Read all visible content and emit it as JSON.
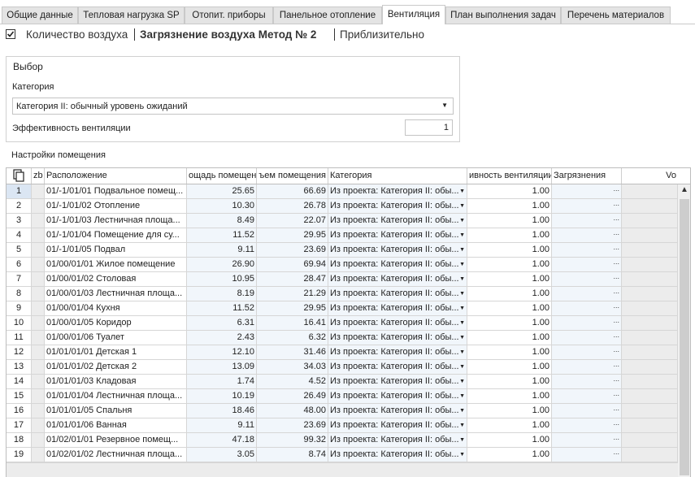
{
  "tabs": [
    {
      "label": "Общие данные",
      "active": false
    },
    {
      "label": "Тепловая нагрузка SP",
      "active": false
    },
    {
      "label": "Отопит. приборы",
      "active": false
    },
    {
      "label": "Панельное отопление",
      "active": false
    },
    {
      "label": "Вентиляция",
      "active": true
    },
    {
      "label": "План выполнения задач",
      "active": false
    },
    {
      "label": "Перечень материалов",
      "active": false
    }
  ],
  "mode": {
    "checked": true,
    "items": [
      "Количество воздуха",
      "Загрязнение воздуха Метод № 2",
      "Приблизительно"
    ],
    "active_index": 1
  },
  "selection": {
    "title": "Выбор",
    "category_label": "Категория",
    "category_value": "Категория II: обычный уровень ожиданий",
    "efficiency_label": "Эффективность вентиляции",
    "efficiency_value": "1"
  },
  "room_settings_label": "Настройки помещения",
  "grid": {
    "copy_icon": "copy-icon",
    "columns": [
      "zb",
      "Расположение",
      "ощадь помещения",
      "ъем помещения",
      "Категория",
      "ивность вентиляции",
      "Загрязнения",
      "Vo"
    ],
    "rows": [
      {
        "n": "1",
        "loc": "01/-1/01/01 Подвальное помещ...",
        "area": "25.65",
        "vol": "66.69",
        "cat": "Из проекта: Категория II: обы...",
        "eff": "1.00"
      },
      {
        "n": "2",
        "loc": "01/-1/01/02 Отопление",
        "area": "10.30",
        "vol": "26.78",
        "cat": "Из проекта: Категория II: обы...",
        "eff": "1.00"
      },
      {
        "n": "3",
        "loc": "01/-1/01/03 Лестничная площа...",
        "area": "8.49",
        "vol": "22.07",
        "cat": "Из проекта: Категория II: обы...",
        "eff": "1.00"
      },
      {
        "n": "4",
        "loc": "01/-1/01/04 Помещение для су...",
        "area": "11.52",
        "vol": "29.95",
        "cat": "Из проекта: Категория II: обы...",
        "eff": "1.00"
      },
      {
        "n": "5",
        "loc": "01/-1/01/05 Подвал",
        "area": "9.11",
        "vol": "23.69",
        "cat": "Из проекта: Категория II: обы...",
        "eff": "1.00"
      },
      {
        "n": "6",
        "loc": "01/00/01/01 Жилое помещение",
        "area": "26.90",
        "vol": "69.94",
        "cat": "Из проекта: Категория II: обы...",
        "eff": "1.00"
      },
      {
        "n": "7",
        "loc": "01/00/01/02 Столовая",
        "area": "10.95",
        "vol": "28.47",
        "cat": "Из проекта: Категория II: обы...",
        "eff": "1.00"
      },
      {
        "n": "8",
        "loc": "01/00/01/03 Лестничная площа...",
        "area": "8.19",
        "vol": "21.29",
        "cat": "Из проекта: Категория II: обы...",
        "eff": "1.00"
      },
      {
        "n": "9",
        "loc": "01/00/01/04 Кухня",
        "area": "11.52",
        "vol": "29.95",
        "cat": "Из проекта: Категория II: обы...",
        "eff": "1.00"
      },
      {
        "n": "10",
        "loc": "01/00/01/05 Коридор",
        "area": "6.31",
        "vol": "16.41",
        "cat": "Из проекта: Категория II: обы...",
        "eff": "1.00"
      },
      {
        "n": "11",
        "loc": "01/00/01/06 Туалет",
        "area": "2.43",
        "vol": "6.32",
        "cat": "Из проекта: Категория II: обы...",
        "eff": "1.00"
      },
      {
        "n": "12",
        "loc": "01/01/01/01 Детская 1",
        "area": "12.10",
        "vol": "31.46",
        "cat": "Из проекта: Категория II: обы...",
        "eff": "1.00"
      },
      {
        "n": "13",
        "loc": "01/01/01/02 Детская 2",
        "area": "13.09",
        "vol": "34.03",
        "cat": "Из проекта: Категория II: обы...",
        "eff": "1.00"
      },
      {
        "n": "14",
        "loc": "01/01/01/03 Кладовая",
        "area": "1.74",
        "vol": "4.52",
        "cat": "Из проекта: Категория II: обы...",
        "eff": "1.00"
      },
      {
        "n": "15",
        "loc": "01/01/01/04 Лестничная площа...",
        "area": "10.19",
        "vol": "26.49",
        "cat": "Из проекта: Категория II: обы...",
        "eff": "1.00"
      },
      {
        "n": "16",
        "loc": "01/01/01/05 Спальня",
        "area": "18.46",
        "vol": "48.00",
        "cat": "Из проекта: Категория II: обы...",
        "eff": "1.00"
      },
      {
        "n": "17",
        "loc": "01/01/01/06 Ванная",
        "area": "9.11",
        "vol": "23.69",
        "cat": "Из проекта: Категория II: обы...",
        "eff": "1.00"
      },
      {
        "n": "18",
        "loc": "01/02/01/01 Резервное помещ...",
        "area": "47.18",
        "vol": "99.32",
        "cat": "Из проекта: Категория II: обы...",
        "eff": "1.00"
      },
      {
        "n": "19",
        "loc": "01/02/01/02 Лестничная площа...",
        "area": "3.05",
        "vol": "8.74",
        "cat": "Из проекта: Категория II: обы...",
        "eff": "1.00"
      }
    ],
    "selected_row": "1",
    "ellipsis": "..."
  }
}
